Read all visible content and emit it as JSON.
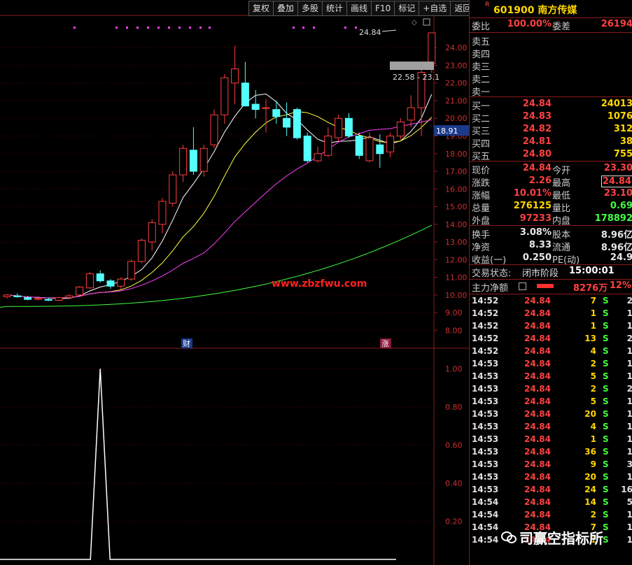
{
  "toolbar": [
    "复权",
    "叠加",
    "多股",
    "统计",
    "画线",
    "F10",
    "标记",
    "+自选",
    "返回"
  ],
  "stock": {
    "code": "601900",
    "name": "南方传媒"
  },
  "chart": {
    "price_axis": [
      "24.00",
      "23.00",
      "22.00",
      "21.00",
      "20.00",
      "19.00",
      "18.00",
      "17.00",
      "16.00",
      "15.00",
      "14.00",
      "13.00",
      "12.00",
      "11.00",
      "10.00",
      "9.00",
      "8.00"
    ],
    "current_price_tag": "18.91",
    "high_label": "24.84",
    "range_label": "22.58 - 23.1",
    "watermark": "www.zbzfwu.com",
    "marker_cai": "财",
    "marker_zhang": "涨",
    "indicator_axis": [
      "1.00",
      "0.80",
      "0.60",
      "0.40",
      "0.20"
    ]
  },
  "chart_data": {
    "type": "candlestick",
    "ylim": [
      7.5,
      24.8
    ],
    "candles": [
      {
        "o": 9.9,
        "h": 10.05,
        "l": 9.8,
        "c": 10.0
      },
      {
        "o": 9.95,
        "h": 10.1,
        "l": 9.85,
        "c": 9.9
      },
      {
        "o": 9.85,
        "h": 9.95,
        "l": 9.7,
        "c": 9.75
      },
      {
        "o": 9.8,
        "h": 9.85,
        "l": 9.7,
        "c": 9.8
      },
      {
        "o": 9.75,
        "h": 9.85,
        "l": 9.65,
        "c": 9.7
      },
      {
        "o": 9.7,
        "h": 9.9,
        "l": 9.65,
        "c": 9.85
      },
      {
        "o": 9.85,
        "h": 10.05,
        "l": 9.8,
        "c": 9.95
      },
      {
        "o": 10.0,
        "h": 10.5,
        "l": 9.95,
        "c": 10.45
      },
      {
        "o": 10.4,
        "h": 11.3,
        "l": 10.35,
        "c": 11.2
      },
      {
        "o": 11.2,
        "h": 11.4,
        "l": 10.7,
        "c": 10.8
      },
      {
        "o": 10.8,
        "h": 10.9,
        "l": 10.35,
        "c": 10.5
      },
      {
        "o": 10.5,
        "h": 11.0,
        "l": 10.3,
        "c": 10.9
      },
      {
        "o": 10.9,
        "h": 12.0,
        "l": 10.8,
        "c": 11.9
      },
      {
        "o": 11.9,
        "h": 13.2,
        "l": 11.8,
        "c": 13.1
      },
      {
        "o": 13.0,
        "h": 14.3,
        "l": 12.5,
        "c": 14.1
      },
      {
        "o": 14.0,
        "h": 15.5,
        "l": 13.5,
        "c": 15.3
      },
      {
        "o": 15.2,
        "h": 17.0,
        "l": 15.0,
        "c": 16.8
      },
      {
        "o": 16.8,
        "h": 18.5,
        "l": 16.4,
        "c": 18.3
      },
      {
        "o": 18.2,
        "h": 19.5,
        "l": 16.8,
        "c": 17.0
      },
      {
        "o": 17.0,
        "h": 18.5,
        "l": 16.7,
        "c": 18.3
      },
      {
        "o": 18.5,
        "h": 20.5,
        "l": 18.3,
        "c": 20.2
      },
      {
        "o": 20.2,
        "h": 22.5,
        "l": 19.7,
        "c": 22.3
      },
      {
        "o": 22.0,
        "h": 24.1,
        "l": 20.8,
        "c": 22.8
      },
      {
        "o": 22.0,
        "h": 23.2,
        "l": 20.7,
        "c": 20.7
      },
      {
        "o": 20.8,
        "h": 21.6,
        "l": 20.0,
        "c": 20.5
      },
      {
        "o": 20.6,
        "h": 21.1,
        "l": 19.2,
        "c": 20.6
      },
      {
        "o": 20.5,
        "h": 21.0,
        "l": 19.7,
        "c": 20.1
      },
      {
        "o": 20.0,
        "h": 20.9,
        "l": 19.0,
        "c": 19.5
      },
      {
        "o": 20.5,
        "h": 20.6,
        "l": 18.8,
        "c": 18.9
      },
      {
        "o": 19.0,
        "h": 19.2,
        "l": 17.5,
        "c": 17.6
      },
      {
        "o": 17.6,
        "h": 18.4,
        "l": 17.5,
        "c": 18.0
      },
      {
        "o": 17.9,
        "h": 19.5,
        "l": 17.8,
        "c": 19.0
      },
      {
        "o": 18.9,
        "h": 20.2,
        "l": 18.7,
        "c": 20.0
      },
      {
        "o": 20.0,
        "h": 20.3,
        "l": 18.9,
        "c": 19.0
      },
      {
        "o": 19.0,
        "h": 19.2,
        "l": 17.7,
        "c": 17.9
      },
      {
        "o": 17.6,
        "h": 19.2,
        "l": 17.5,
        "c": 18.9
      },
      {
        "o": 18.5,
        "h": 19.1,
        "l": 17.2,
        "c": 18.0
      },
      {
        "o": 18.1,
        "h": 19.2,
        "l": 17.8,
        "c": 19.0
      },
      {
        "o": 19.0,
        "h": 20.0,
        "l": 18.8,
        "c": 19.8
      },
      {
        "o": 19.9,
        "h": 21.3,
        "l": 19.5,
        "c": 20.6
      },
      {
        "o": 20.6,
        "h": 22.8,
        "l": 19.0,
        "c": 22.6
      },
      {
        "o": 23.1,
        "h": 24.84,
        "l": 22.58,
        "c": 24.84
      }
    ],
    "indicator": {
      "ylim": [
        0,
        1.1
      ],
      "spike_index": 9,
      "spike_value": 1.0
    }
  },
  "quote": {
    "weibi": {
      "label": "委比",
      "value": "100.00%"
    },
    "weicha": {
      "label": "委差",
      "value": "26194"
    },
    "sell": [
      {
        "label": "卖五"
      },
      {
        "label": "卖四"
      },
      {
        "label": "卖三"
      },
      {
        "label": "卖二"
      },
      {
        "label": "卖一"
      }
    ],
    "buy": [
      {
        "label": "买一",
        "price": "24.84",
        "vol": "24013"
      },
      {
        "label": "买二",
        "price": "24.83",
        "vol": "1076"
      },
      {
        "label": "买三",
        "price": "24.82",
        "vol": "312"
      },
      {
        "label": "买四",
        "price": "24.81",
        "vol": "38"
      },
      {
        "label": "买五",
        "price": "24.80",
        "vol": "755"
      }
    ],
    "stats": [
      {
        "l1": "现价",
        "v1": "24.84",
        "c1": "red",
        "l2": "今开",
        "v2": "23.30",
        "c2": "red"
      },
      {
        "l1": "涨跌",
        "v1": "2.26",
        "c1": "red",
        "l2": "最高",
        "v2": "24.84",
        "c2": "red"
      },
      {
        "l1": "涨幅",
        "v1": "10.01%",
        "c1": "red",
        "l2": "最低",
        "v2": "23.10",
        "c2": "red"
      },
      {
        "l1": "总量",
        "v1": "276125",
        "c1": "yel",
        "l2": "量比",
        "v2": "0.69",
        "c2": "grn"
      },
      {
        "l1": "外盘",
        "v1": "97233",
        "c1": "red",
        "l2": "内盘",
        "v2": "178892",
        "c2": "grn"
      }
    ],
    "stats2": [
      {
        "l1": "换手",
        "v1": "3.08%",
        "l2": "股本",
        "v2": "8.96亿"
      },
      {
        "l1": "净资",
        "v1": "8.33",
        "l2": "流通",
        "v2": "8.96亿"
      },
      {
        "l1": "收益(一)",
        "v1": "0.250",
        "l2": "PE(动)",
        "v2": "24.9"
      }
    ],
    "status_label": "交易状态:",
    "status_value": "闭市阶段",
    "status_time": "15:00:01",
    "main_net_label": "主力净额",
    "main_net_value": "8276万",
    "main_net_pct": "12%"
  },
  "ticks": [
    {
      "t": "14:52",
      "p": "24.84",
      "v": "7",
      "s": "S",
      "n": "2"
    },
    {
      "t": "14:52",
      "p": "24.84",
      "v": "1",
      "s": "S",
      "n": "1"
    },
    {
      "t": "14:52",
      "p": "24.84",
      "v": "1",
      "s": "S",
      "n": "1"
    },
    {
      "t": "14:52",
      "p": "24.84",
      "v": "13",
      "s": "S",
      "n": "2"
    },
    {
      "t": "14:52",
      "p": "24.84",
      "v": "4",
      "s": "S",
      "n": "1"
    },
    {
      "t": "14:53",
      "p": "24.84",
      "v": "2",
      "s": "S",
      "n": "1"
    },
    {
      "t": "14:53",
      "p": "24.84",
      "v": "5",
      "s": "S",
      "n": "1"
    },
    {
      "t": "14:53",
      "p": "24.84",
      "v": "2",
      "s": "S",
      "n": "2"
    },
    {
      "t": "14:53",
      "p": "24.84",
      "v": "5",
      "s": "S",
      "n": "1"
    },
    {
      "t": "14:53",
      "p": "24.84",
      "v": "20",
      "s": "S",
      "n": "1"
    },
    {
      "t": "14:53",
      "p": "24.84",
      "v": "4",
      "s": "S",
      "n": "1"
    },
    {
      "t": "14:53",
      "p": "24.84",
      "v": "1",
      "s": "S",
      "n": "1"
    },
    {
      "t": "14:53",
      "p": "24.84",
      "v": "36",
      "s": "S",
      "n": "1"
    },
    {
      "t": "14:53",
      "p": "24.84",
      "v": "9",
      "s": "S",
      "n": "3"
    },
    {
      "t": "14:53",
      "p": "24.84",
      "v": "20",
      "s": "S",
      "n": "1"
    },
    {
      "t": "14:53",
      "p": "24.84",
      "v": "24",
      "s": "S",
      "n": "16"
    },
    {
      "t": "14:54",
      "p": "24.84",
      "v": "14",
      "s": "S",
      "n": "5"
    },
    {
      "t": "14:54",
      "p": "24.84",
      "v": "2",
      "s": "S",
      "n": "1"
    },
    {
      "t": "14:54",
      "p": "24.84",
      "v": "7",
      "s": "S",
      "n": "1"
    },
    {
      "t": "14:54",
      "p": "24.84",
      "v": "1",
      "s": "S",
      "n": "1"
    }
  ],
  "watermark2": "司赢空指标所"
}
